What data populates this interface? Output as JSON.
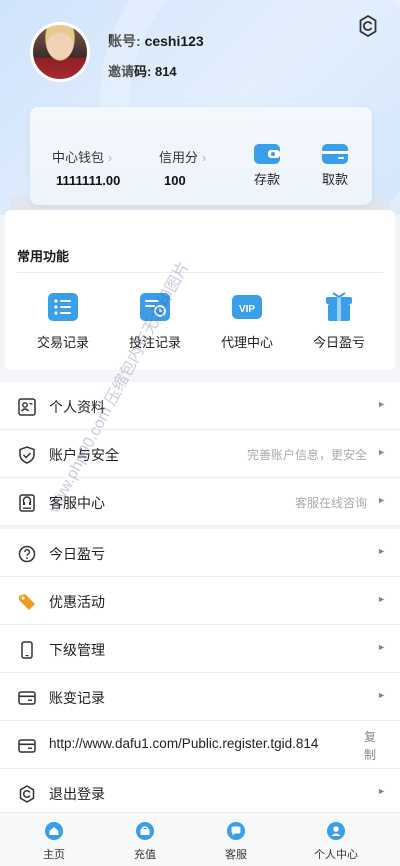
{
  "profile": {
    "account_label": "账号:",
    "account": "ceshi123",
    "invite_label": "邀请码:",
    "invite_code": "814"
  },
  "wallet": {
    "center_label": "中心钱包",
    "center_value": "1111111.00",
    "credit_label": "信用分",
    "credit_value": "100",
    "deposit_label": "存款",
    "withdraw_label": "取款"
  },
  "common": {
    "title": "常用功能",
    "items": [
      {
        "label": "交易记录",
        "icon": "list-icon"
      },
      {
        "label": "投注记录",
        "icon": "bet-clock-icon"
      },
      {
        "label": "代理中心",
        "icon": "vip-icon"
      },
      {
        "label": "今日盈亏",
        "icon": "gift-icon"
      }
    ]
  },
  "menu": [
    {
      "label": "个人资料",
      "hint": "",
      "icon": "id-card-icon"
    },
    {
      "label": "账户与安全",
      "hint": "完善账户信息，更安全",
      "icon": "shield-check-icon"
    },
    {
      "label": "客服中心",
      "hint": "客服在线咨询",
      "icon": "headset-book-icon"
    },
    {
      "label": "今日盈亏",
      "hint": "",
      "icon": "question-circle-icon"
    },
    {
      "label": "优惠活动",
      "hint": "",
      "icon": "tag-icon"
    },
    {
      "label": "下级管理",
      "hint": "",
      "icon": "phone-icon"
    },
    {
      "label": "账变记录",
      "hint": "",
      "icon": "card-icon"
    },
    {
      "label": "http://www.dafu1.com/Public.register.tgid.814",
      "hint": "",
      "icon": "card-icon",
      "action": "复制"
    },
    {
      "label": "退出登录",
      "hint": "",
      "icon": "logout-gear-icon"
    }
  ],
  "tabs": [
    {
      "label": "主页",
      "icon": "home-icon"
    },
    {
      "label": "充值",
      "icon": "recharge-icon"
    },
    {
      "label": "客服",
      "icon": "chat-icon"
    },
    {
      "label": "个人中心",
      "icon": "user-icon"
    }
  ],
  "watermark": "www.php90.com 压缩包内有无水印图片",
  "colors": {
    "accent": "#3a9ee8",
    "header_bg": "#d8e9fc"
  }
}
